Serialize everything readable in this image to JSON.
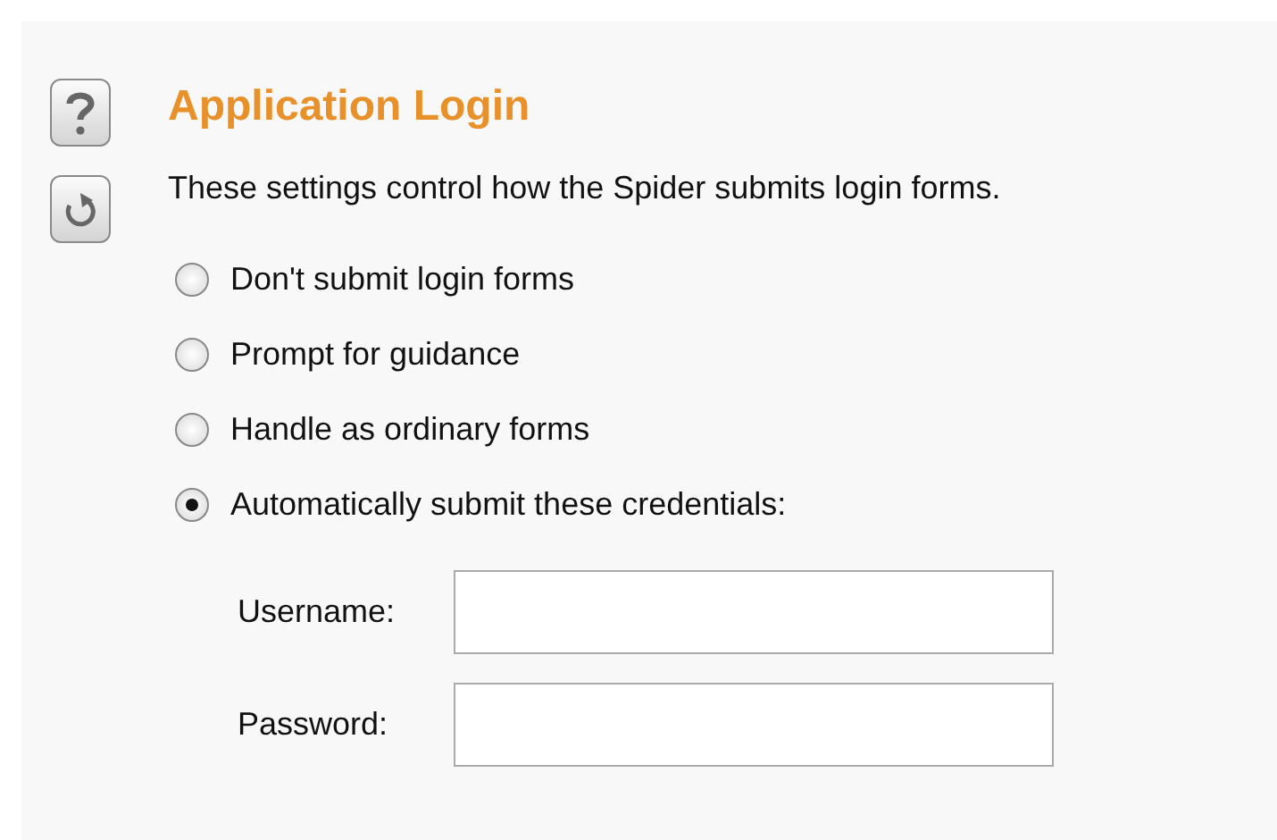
{
  "title": "Application Login",
  "description": "These settings control how the Spider submits login forms.",
  "options": [
    {
      "label": "Don't submit login forms",
      "selected": false
    },
    {
      "label": "Prompt for guidance",
      "selected": false
    },
    {
      "label": "Handle as ordinary forms",
      "selected": false
    },
    {
      "label": "Automatically submit these credentials:",
      "selected": true
    }
  ],
  "fields": [
    {
      "label": "Username:"
    },
    {
      "label": "Password:"
    }
  ]
}
